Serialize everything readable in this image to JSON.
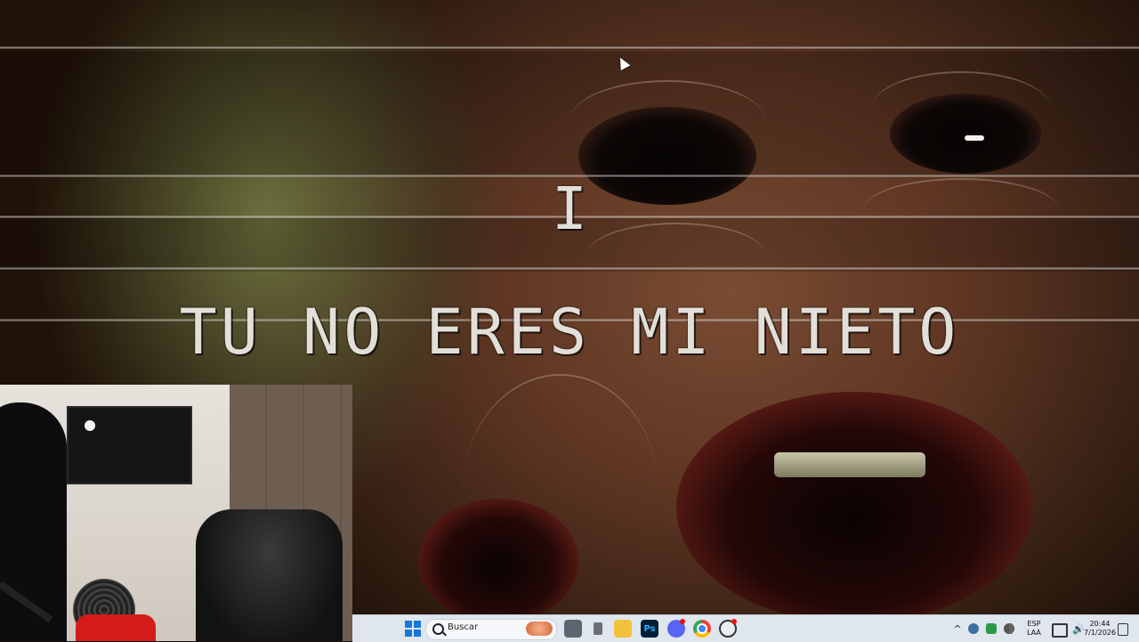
{
  "game": {
    "prompt_letter": "I",
    "subtitle": "TU NO ERES MI NIETO"
  },
  "taskbar": {
    "search_label": "Buscar",
    "apps": [
      {
        "name": "Task View",
        "icon": "task-view-icon"
      },
      {
        "name": "Printer",
        "icon": "printer-icon"
      },
      {
        "name": "File Explorer",
        "icon": "folder-icon"
      },
      {
        "name": "Photoshop",
        "icon": "photoshop-icon",
        "label": "Ps"
      },
      {
        "name": "Discord",
        "icon": "discord-icon"
      },
      {
        "name": "Chrome",
        "icon": "chrome-icon"
      },
      {
        "name": "Recording app",
        "icon": "record-icon"
      }
    ],
    "tray": {
      "language_top": "ESP",
      "language_bottom": "LAA",
      "time": "20:44",
      "date": "7/1/2026"
    }
  },
  "colors": {
    "taskbar_bg": "#dfe6ee",
    "subtitle_text": "#e2ded8",
    "windows_blue": "#1479d8",
    "ps_blue": "#001e36",
    "discord": "#5865f2"
  }
}
